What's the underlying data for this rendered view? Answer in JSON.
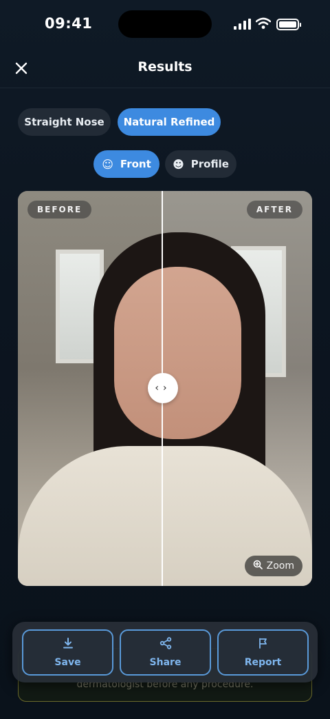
{
  "status": {
    "time": "09:41"
  },
  "header": {
    "title": "Results",
    "close_icon": "close-icon"
  },
  "style_options": [
    {
      "label": "Straight Nose",
      "active": false
    },
    {
      "label": "Natural Refined",
      "active": true
    }
  ],
  "view_options": [
    {
      "label": "Front",
      "icon": "face-front-icon",
      "active": true
    },
    {
      "label": "Profile",
      "icon": "face-profile-icon",
      "active": false
    }
  ],
  "comparison": {
    "before_label": "BEFORE",
    "after_label": "AFTER",
    "zoom_label": "Zoom"
  },
  "disclaimer": {
    "text": "dermatologist before any procedure."
  },
  "toolbar": {
    "save_label": "Save",
    "share_label": "Share",
    "report_label": "Report"
  },
  "colors": {
    "accent": "#3d8ae0",
    "background": "#0f1a26"
  }
}
